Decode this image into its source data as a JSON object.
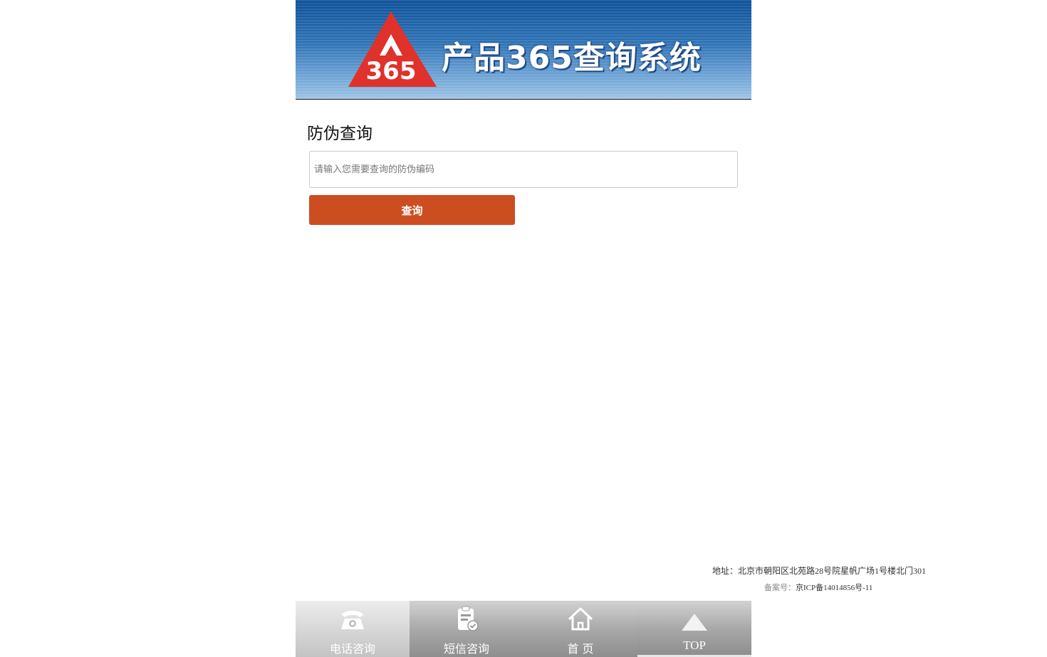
{
  "banner": {
    "logo_text": "365",
    "title": "产品365查询系统"
  },
  "section": {
    "title": "防伪查询"
  },
  "search": {
    "placeholder": "请输入您需要查询的防伪编码",
    "value": "",
    "button_label": "查询"
  },
  "footer": {
    "address": "地址：北京市朝阳区北苑路28号院星帆广场1号楼北门301",
    "icp_label": "备案号：",
    "icp_value": "京ICP备14014856号-11"
  },
  "bottom_nav": {
    "items": [
      {
        "label": "电话咨询",
        "icon": "telephone-icon",
        "active": true
      },
      {
        "label": "短信咨询",
        "icon": "sms-clipboard-icon",
        "active": false
      },
      {
        "label": "首 页",
        "icon": "home-icon",
        "active": false
      },
      {
        "label": "TOP",
        "icon": "triangle-up-icon",
        "active": false
      }
    ]
  },
  "colors": {
    "banner_top": "#0a4f98",
    "banner_bottom": "#9cc3e6",
    "logo_red": "#e0312b",
    "button": "#cc4e20",
    "nav_gray": "#a9a9a9"
  }
}
